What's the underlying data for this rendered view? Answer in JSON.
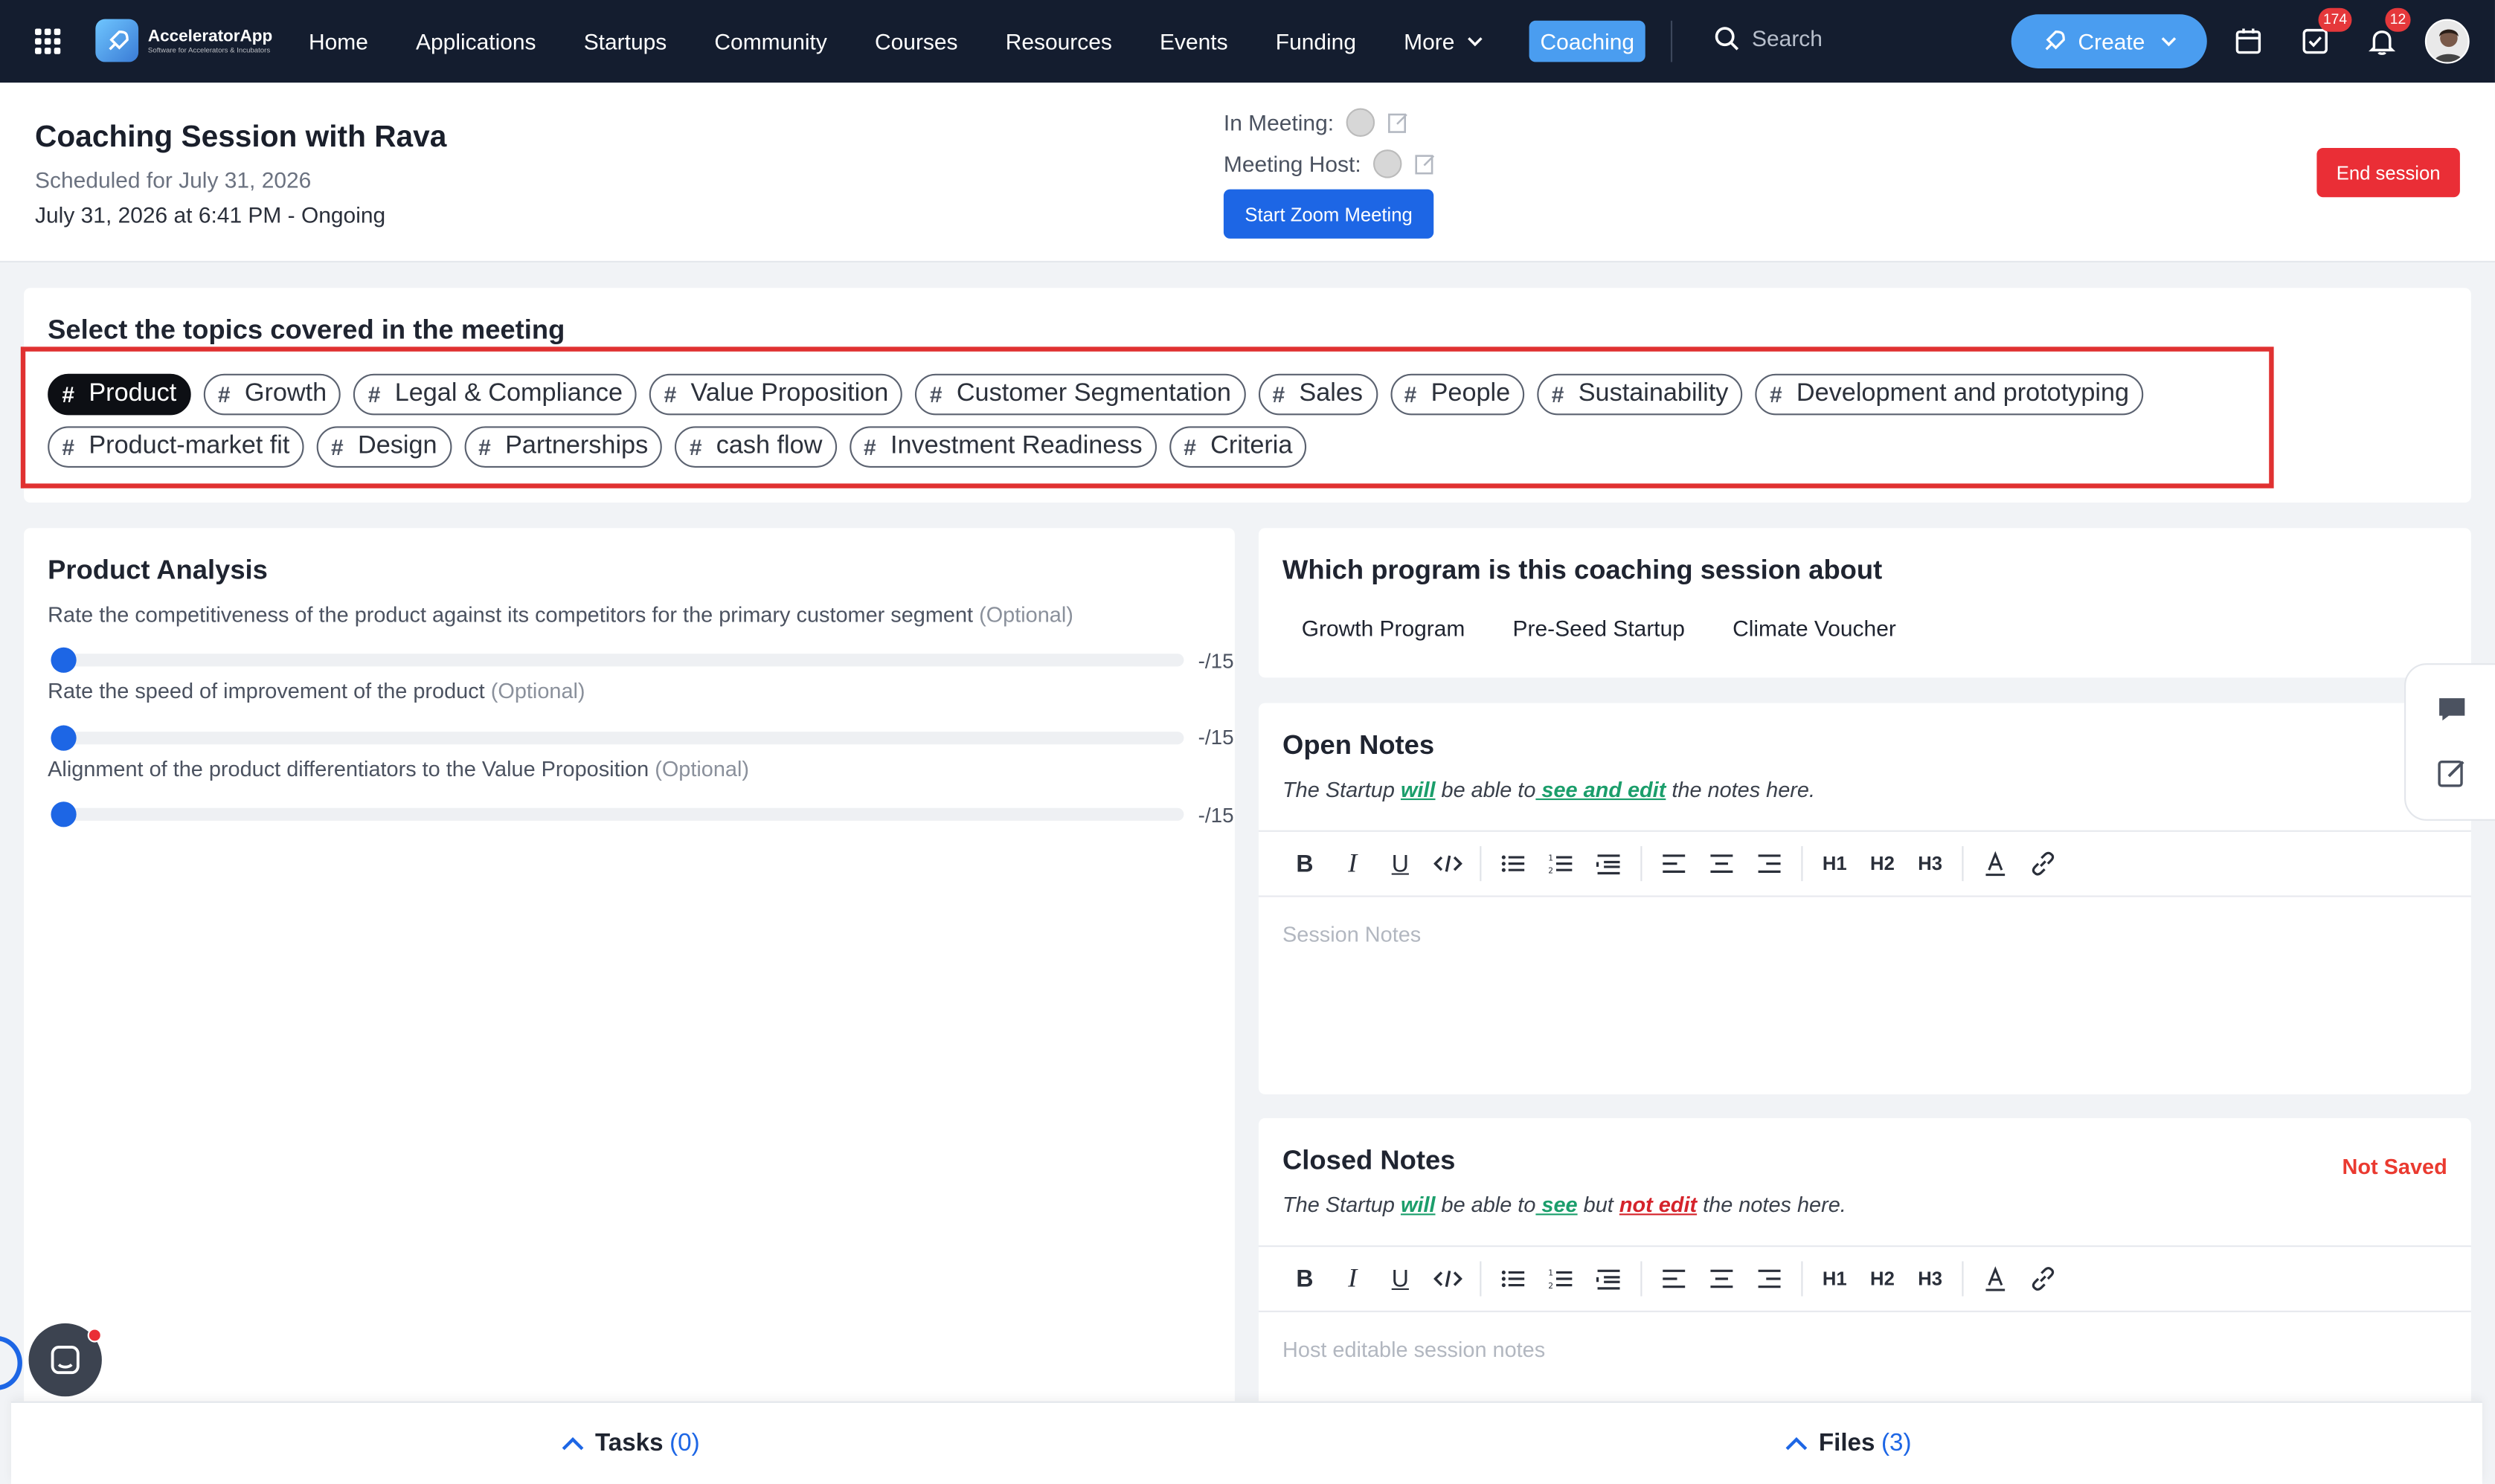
{
  "nav": {
    "brand": "AcceleratorApp",
    "brand_tag": "Software for Accelerators & Incubators",
    "links": [
      "Home",
      "Applications",
      "Startups",
      "Community",
      "Courses",
      "Resources",
      "Events",
      "Funding",
      "More"
    ],
    "active": "Coaching",
    "search_placeholder": "Search",
    "create_label": "Create",
    "tasks_badge": "174",
    "notifications_badge": "12"
  },
  "header": {
    "title": "Coaching Session with Rava",
    "scheduled": "Scheduled for July 31, 2026",
    "datetime": "July 31, 2026 at 6:41 PM - Ongoing",
    "in_meeting_label": "In Meeting:",
    "host_label": "Meeting Host:",
    "zoom_button": "Start Zoom Meeting",
    "end_button": "End session"
  },
  "topics": {
    "title": "Select the topics covered in the meeting",
    "row1": [
      "Product",
      "Growth",
      "Legal & Compliance",
      "Value Proposition",
      "Customer Segmentation",
      "Sales",
      "People",
      "Sustainability",
      "Development and prototyping"
    ],
    "row2": [
      "Product-market fit",
      "Design",
      "Partnerships",
      "cash flow",
      "Investment Readiness",
      "Criteria"
    ],
    "selected": "Product"
  },
  "analysis": {
    "title": "Product Analysis",
    "questions": [
      {
        "label": "Rate the competitiveness of the product against its competitors for the primary customer segment",
        "optional": "(Optional)",
        "value": "-/15"
      },
      {
        "label": "Rate the speed of improvement of the product",
        "optional": "(Optional)",
        "value": "-/15"
      },
      {
        "label": "Alignment of the product differentiators to the Value Proposition",
        "optional": "(Optional)",
        "value": "-/15"
      }
    ]
  },
  "program": {
    "title": "Which program is this coaching session about",
    "options": [
      "Growth Program",
      "Pre-Seed Startup",
      "Climate Voucher"
    ]
  },
  "open_notes": {
    "title": "Open Notes",
    "desc_a": "The Startup ",
    "desc_b": "will",
    "desc_c": " be able to",
    "desc_d": " see and edit",
    "desc_e": " the notes here.",
    "placeholder": "Session Notes"
  },
  "closed_notes": {
    "title": "Closed Notes",
    "status": "Not Saved",
    "desc_a": "The Startup ",
    "desc_b": "will",
    "desc_c": " be able to",
    "desc_d": " see",
    "desc_e": " but ",
    "desc_f": "not edit",
    "desc_g": " the notes here.",
    "placeholder": "Host editable session notes"
  },
  "toolbar": {
    "h1": "H1",
    "h2": "H2",
    "h3": "H3"
  },
  "bottom": {
    "tasks_label": "Tasks",
    "tasks_count": "(0)",
    "files_label": "Files",
    "files_count": "(3)"
  },
  "colors": {
    "nav_bg": "#141d2f",
    "accent": "#1d66e5",
    "danger": "#ea2e36",
    "success": "#1b9e6b"
  }
}
